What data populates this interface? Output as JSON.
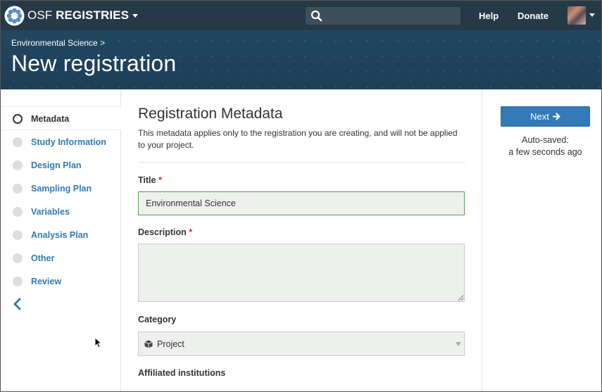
{
  "navbar": {
    "brand_light": "OSF ",
    "brand_bold": "REGISTRIES",
    "brand_icon": "osf-flower-logo",
    "search_placeholder": "",
    "help_label": "Help",
    "donate_label": "Donate"
  },
  "header": {
    "breadcrumb": "Environmental Science >",
    "title": "New registration"
  },
  "sidebar": {
    "items": [
      {
        "label": "Metadata",
        "active": true
      },
      {
        "label": "Study Information",
        "active": false
      },
      {
        "label": "Design Plan",
        "active": false
      },
      {
        "label": "Sampling Plan",
        "active": false
      },
      {
        "label": "Variables",
        "active": false
      },
      {
        "label": "Analysis Plan",
        "active": false
      },
      {
        "label": "Other",
        "active": false
      },
      {
        "label": "Review",
        "active": false
      }
    ]
  },
  "main": {
    "title": "Registration Metadata",
    "description": "This metadata applies only to the registration you are creating, and will not be applied to your project.",
    "title_label": "Title",
    "title_value": "Environmental Science",
    "description_label": "Description",
    "description_value": "",
    "category_label": "Category",
    "category_value": "Project",
    "affiliated_label": "Affiliated institutions",
    "required_marker": "*"
  },
  "right_panel": {
    "next_label": "Next",
    "autosave_line1": "Auto-saved:",
    "autosave_line2": "a few seconds ago"
  },
  "colors": {
    "navbar": "#263947",
    "hero": "#214762",
    "link": "#337ab7",
    "required": "#c9302c",
    "valid_border": "#5b9a55"
  }
}
